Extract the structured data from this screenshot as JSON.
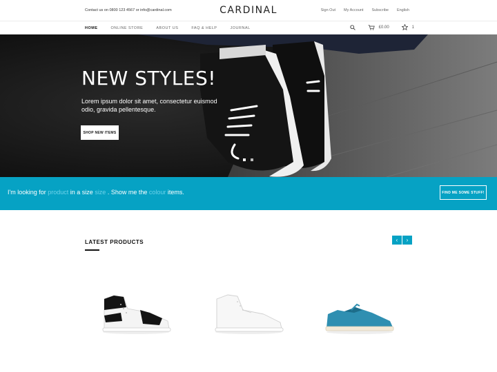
{
  "header": {
    "contact": "Contact us on 0800 123 4567 or info@cardinal.com",
    "brand": "CARDINAL",
    "links": [
      "Sign Out",
      "My Account",
      "Subscribe",
      "English"
    ]
  },
  "nav": {
    "items": [
      "HOME",
      "ONLINE STORE",
      "ABOUT US",
      "FAQ & HELP",
      "JOURNAL"
    ],
    "cart_amount": "£0.00",
    "wishlist_count": "1"
  },
  "hero": {
    "title": "NEW STYLES!",
    "subtitle": "Lorem ipsum dolor sit amet, consectetur euismod odio, gravida pellentesque.",
    "button": "SHOP NEW ITEMS"
  },
  "filter": {
    "t1": "I'm looking for ",
    "product": "product",
    "t2": " in a size ",
    "size": "size",
    "t3": " . Show me the ",
    "colour": "colour",
    "t4": " items.",
    "button": "FIND ME SOME STUFF!"
  },
  "latest": {
    "title": "LATEST PRODUCTS",
    "prev": "‹",
    "next": "›"
  },
  "colors": {
    "accent": "#06a2c4",
    "highlight": "#6fd3ea"
  }
}
